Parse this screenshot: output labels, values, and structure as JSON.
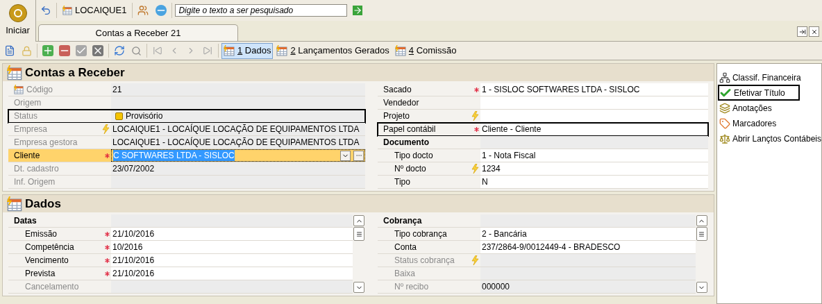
{
  "app_button": {
    "label": "Iniciar"
  },
  "header": {
    "company": "LOCAIQUE1",
    "search": {
      "placeholder": "Digite o texto a ser pesquisado"
    }
  },
  "document_tabs": [
    {
      "label": "Contas a Receber 21",
      "selected": true
    }
  ],
  "view_tabs": [
    {
      "label": "1 Dados",
      "selected": true
    },
    {
      "label": "2 Lançamentos Gerados",
      "selected": false
    },
    {
      "label": "4 Comissão",
      "selected": false
    }
  ],
  "panels": [
    {
      "title": "Contas a Receber",
      "scrollable": false,
      "columns": [
        [
          {
            "kind": "key_field",
            "label": "Código",
            "value": "21",
            "enabled": false,
            "editable": false,
            "required": false,
            "lookup": false,
            "focused": false,
            "outlined": false
          },
          {
            "kind": "field",
            "label": "Origem",
            "enabled": false,
            "editable": false,
            "required": false,
            "lookup": false,
            "focused": false,
            "outlined": false
          },
          {
            "kind": "status_field",
            "label": "Status",
            "value": "Provisório",
            "color": "#f5c400",
            "enabled": false,
            "editable": false,
            "required": false,
            "lookup": false,
            "focused": false,
            "outlined": true
          },
          {
            "kind": "field",
            "label": "Empresa",
            "value": "LOCAIQUE1 - LOCAÍQUE LOCAÇÃO DE EQUIPAMENTOS LTDA",
            "enabled": false,
            "editable": false,
            "required": false,
            "lookup": true,
            "focused": false,
            "outlined": false
          },
          {
            "kind": "field",
            "label": "Empresa gestora",
            "value": "LOCAIQUE1 - LOCAÍQUE LOCAÇÃO DE EQUIPAMENTOS LTDA",
            "enabled": false,
            "editable": false,
            "required": false,
            "lookup": false,
            "focused": false,
            "outlined": false
          },
          {
            "kind": "field",
            "label": "Cliente",
            "value": "C SOFTWARES LTDA - SISLOC",
            "enabled": true,
            "editable": true,
            "required": true,
            "lookup": false,
            "focused": true,
            "outlined": false
          },
          {
            "kind": "field",
            "label": "Dt. cadastro",
            "value": "23/07/2002",
            "enabled": false,
            "editable": false,
            "required": false,
            "lookup": false,
            "focused": false,
            "outlined": false
          },
          {
            "kind": "field",
            "label": "Inf. Origem",
            "enabled": false,
            "editable": false,
            "required": false,
            "lookup": false,
            "focused": false,
            "outlined": false
          }
        ],
        [
          {
            "kind": "field",
            "label": "Sacado",
            "value": "1 - SISLOC SOFTWARES LTDA - SISLOC",
            "enabled": true,
            "editable": true,
            "required": true,
            "lookup": false,
            "focused": false,
            "outlined": false
          },
          {
            "kind": "field",
            "label": "Vendedor",
            "enabled": true,
            "editable": true,
            "required": false,
            "lookup": false,
            "focused": false,
            "outlined": false
          },
          {
            "kind": "field",
            "label": "Projeto",
            "enabled": true,
            "editable": true,
            "required": false,
            "lookup": true,
            "focused": false,
            "outlined": false
          },
          {
            "kind": "field",
            "label": "Papel contábil",
            "value": "Cliente - Cliente",
            "enabled": true,
            "editable": true,
            "required": true,
            "lookup": false,
            "focused": false,
            "outlined": true
          },
          {
            "kind": "group",
            "label": "Documento",
            "children": [
              {
                "kind": "field",
                "label": "Tipo docto",
                "value": "1 - Nota Fiscal",
                "enabled": true,
                "editable": true,
                "required": false,
                "lookup": false,
                "focused": false,
                "outlined": false
              },
              {
                "kind": "field",
                "label": "Nº docto",
                "value": "1234",
                "enabled": true,
                "editable": true,
                "required": false,
                "lookup": true,
                "focused": false,
                "outlined": false
              },
              {
                "kind": "field",
                "label": "Tipo",
                "value": "N",
                "enabled": true,
                "editable": true,
                "required": false,
                "lookup": false,
                "focused": false,
                "outlined": false
              }
            ]
          }
        ]
      ]
    },
    {
      "title": "Dados",
      "scrollable": true,
      "columns": [
        [
          {
            "kind": "group",
            "label": "Datas",
            "children": [
              {
                "kind": "field",
                "label": "Emissão",
                "value": "21/10/2016",
                "enabled": true,
                "editable": true,
                "required": true,
                "lookup": false,
                "focused": false,
                "outlined": false
              },
              {
                "kind": "field",
                "label": "Competência",
                "value": "10/2016",
                "enabled": true,
                "editable": true,
                "required": true,
                "lookup": false,
                "focused": false,
                "outlined": false
              },
              {
                "kind": "field",
                "label": "Vencimento",
                "value": "21/10/2016",
                "enabled": true,
                "editable": true,
                "required": true,
                "lookup": false,
                "focused": false,
                "outlined": false
              },
              {
                "kind": "field",
                "label": "Prevista",
                "value": "21/10/2016",
                "enabled": true,
                "editable": true,
                "required": true,
                "lookup": false,
                "focused": false,
                "outlined": false
              },
              {
                "kind": "field",
                "label": "Cancelamento",
                "enabled": false,
                "editable": false,
                "required": false,
                "lookup": false,
                "focused": false,
                "outlined": false
              }
            ]
          }
        ],
        [
          {
            "kind": "group",
            "label": "Cobrança",
            "children": [
              {
                "kind": "field",
                "label": "Tipo cobrança",
                "value": "2 - Bancária",
                "enabled": true,
                "editable": true,
                "required": false,
                "lookup": false,
                "focused": false,
                "outlined": false
              },
              {
                "kind": "field",
                "label": "Conta",
                "value": "237/2864-9/0012449-4 - BRADESCO",
                "enabled": true,
                "editable": true,
                "required": false,
                "lookup": false,
                "focused": false,
                "outlined": false
              },
              {
                "kind": "field",
                "label": "Status cobrança",
                "enabled": false,
                "editable": false,
                "required": false,
                "lookup": true,
                "focused": false,
                "outlined": false
              },
              {
                "kind": "field",
                "label": "Baixa",
                "enabled": false,
                "editable": false,
                "required": false,
                "lookup": false,
                "focused": false,
                "outlined": false
              },
              {
                "kind": "field",
                "label": "Nº recibo",
                "value": "000000",
                "enabled": false,
                "editable": false,
                "required": false,
                "lookup": false,
                "focused": false,
                "outlined": false
              }
            ]
          }
        ]
      ]
    }
  ],
  "side_actions": [
    {
      "label": "Classif. Financeira",
      "outlined": false
    },
    {
      "label": "Efetivar Título",
      "outlined": true
    },
    {
      "label": "Anotações",
      "outlined": false
    },
    {
      "label": "Marcadores",
      "outlined": false
    },
    {
      "label": "Abrir Lançtos Contábeis",
      "outlined": false
    }
  ]
}
